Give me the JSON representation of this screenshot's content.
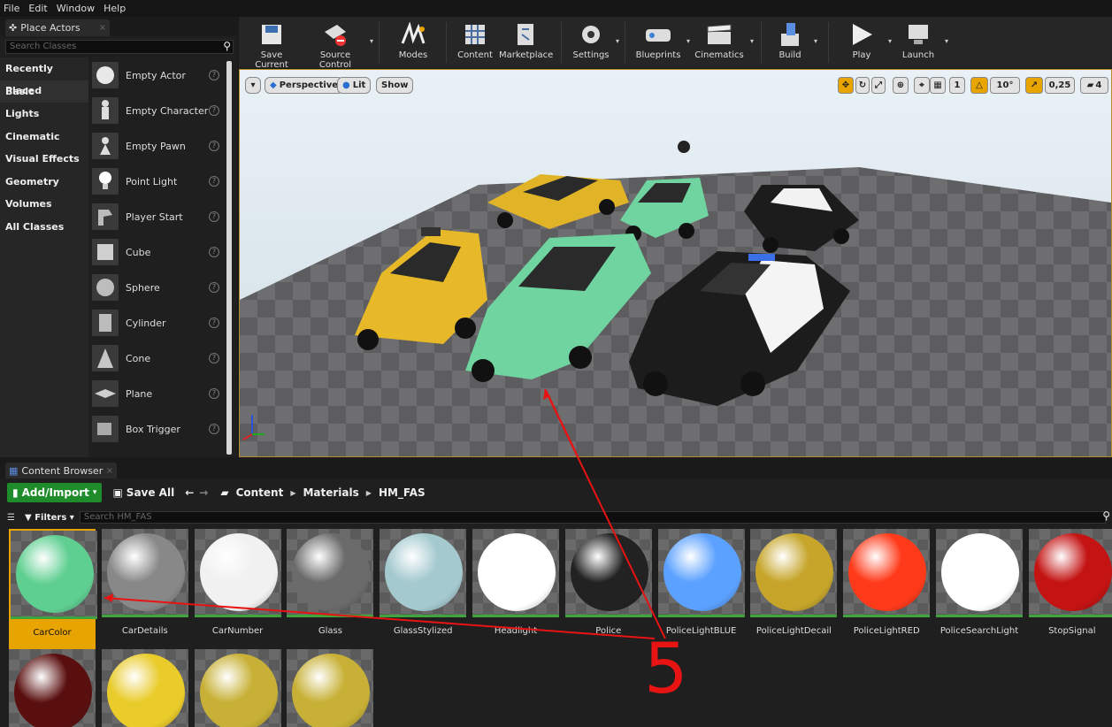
{
  "menu": [
    "File",
    "Edit",
    "Window",
    "Help"
  ],
  "place_actors": {
    "tab_title": "Place Actors",
    "search_placeholder": "Search Classes",
    "categories": [
      "Recently Placed",
      "Basic",
      "Lights",
      "Cinematic",
      "Visual Effects",
      "Geometry",
      "Volumes",
      "All Classes"
    ],
    "selected_category": "Basic",
    "items": [
      "Empty Actor",
      "Empty Character",
      "Empty Pawn",
      "Point Light",
      "Player Start",
      "Cube",
      "Sphere",
      "Cylinder",
      "Cone",
      "Plane",
      "Box Trigger"
    ]
  },
  "toolbar": {
    "buttons": [
      "Save Current",
      "Source Control",
      "Modes",
      "Content",
      "Marketplace",
      "Settings",
      "Blueprints",
      "Cinematics",
      "Build",
      "Play",
      "Launch"
    ]
  },
  "viewport": {
    "view_mode": "Perspective",
    "lit_mode": "Lit",
    "show": "Show",
    "rotation_snap": "10°",
    "scale_snap": "0,25",
    "camera_speed": "4"
  },
  "content_browser": {
    "tab_title": "Content Browser",
    "add_import": "Add/Import",
    "save_all": "Save All",
    "breadcrumb": [
      "Content",
      "Materials",
      "HM_FAS"
    ],
    "filters": "Filters",
    "search_placeholder": "Search HM_FAS",
    "assets": [
      {
        "name": "CarColor",
        "color": "#5fcf91",
        "selected": true
      },
      {
        "name": "CarDetails",
        "color": "#888888"
      },
      {
        "name": "CarNumber",
        "color": "#f1f1f1"
      },
      {
        "name": "Glass",
        "color": "#6b6b6b"
      },
      {
        "name": "GlassStylized",
        "color": "#a4c9cf"
      },
      {
        "name": "Headlight",
        "color": "#ffffff"
      },
      {
        "name": "Police",
        "color": "#222222"
      },
      {
        "name": "PoliceLightBLUE",
        "color": "#5ba1ff"
      },
      {
        "name": "PoliceLightDecail",
        "color": "#c6a52a"
      },
      {
        "name": "PoliceLightRED",
        "color": "#ff3a1a"
      },
      {
        "name": "PoliceSearchLight",
        "color": "#ffffff"
      },
      {
        "name": "StopSignal",
        "color": "#c41313"
      }
    ],
    "assets_row2": [
      {
        "color": "#5a0f0f"
      },
      {
        "color": "#e9cb2a"
      },
      {
        "color": "#c7b035"
      },
      {
        "color": "#c7b035"
      }
    ]
  },
  "annotation": {
    "number": "5",
    "color": "#e81313"
  }
}
